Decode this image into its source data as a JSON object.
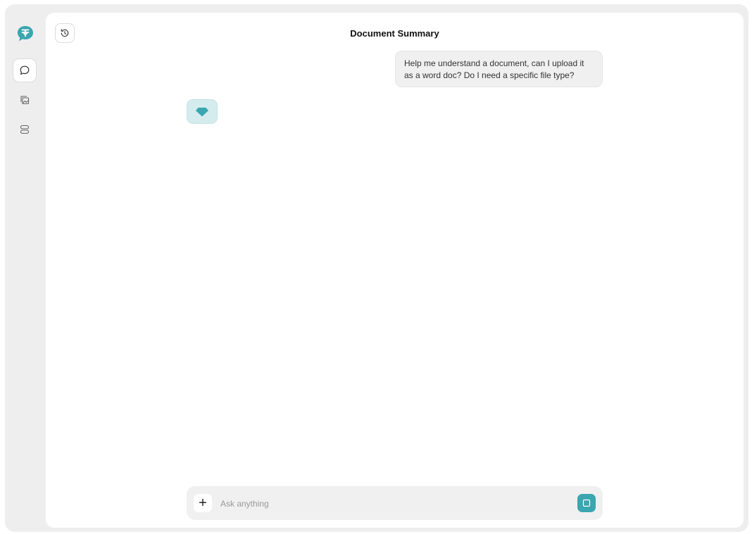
{
  "header": {
    "title": "Document Summary"
  },
  "sidebar": {
    "items": [
      {
        "name": "chat",
        "icon": "chat-bubble-icon",
        "active": true
      },
      {
        "name": "gallery",
        "icon": "image-gallery-icon",
        "active": false
      },
      {
        "name": "storage",
        "icon": "storage-icon",
        "active": false
      }
    ]
  },
  "conversation": {
    "messages": [
      {
        "role": "user",
        "text": "Help me understand a document, can I upload it as a word doc? Do I need a specific file type?"
      },
      {
        "role": "assistant",
        "text": ""
      }
    ]
  },
  "composer": {
    "placeholder": "Ask anything",
    "add_label": "+"
  },
  "colors": {
    "accent": "#3aa6b0",
    "frame_bg": "#eeeeee",
    "panel_bg": "#ffffff",
    "bubble_bg": "#f0f0f0",
    "avatar_bg": "#d5ecee"
  }
}
